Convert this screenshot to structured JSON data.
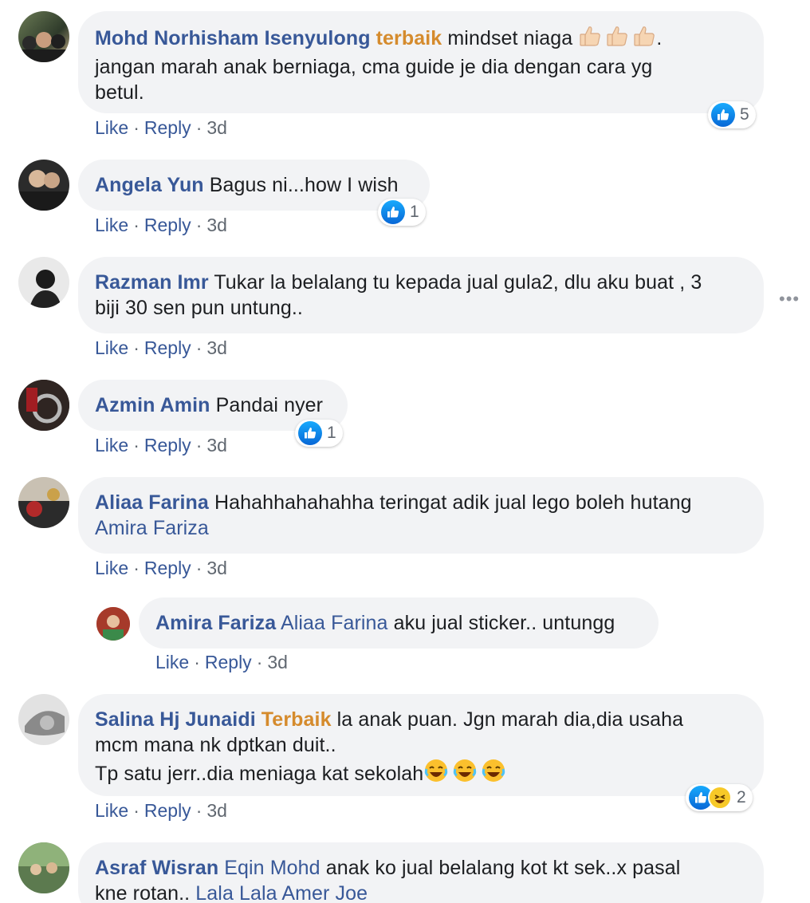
{
  "comments": [
    {
      "author": "Mohd Norhisham Isenyulong",
      "highlight": "terbaik",
      "text_a": " mindset niaga ",
      "text_b": ".",
      "line2": "jangan marah anak berniaga, cma guide je dia dengan cara yg",
      "line3": "betul.",
      "like": "Like",
      "reply": "Reply",
      "time": "3d",
      "reaction_count": "5"
    },
    {
      "author": "Angela Yun",
      "text": "Bagus ni...how I wish",
      "like": "Like",
      "reply": "Reply",
      "time": "3d",
      "reaction_count": "1"
    },
    {
      "author": "Razman Imr",
      "text": "Tukar la belalang tu kepada jual gula2, dlu aku buat , 3",
      "line2": "biji 30 sen pun untung..",
      "like": "Like",
      "reply": "Reply",
      "time": "3d"
    },
    {
      "author": "Azmin Amin",
      "text": "Pandai nyer",
      "like": "Like",
      "reply": "Reply",
      "time": "3d",
      "reaction_count": "1"
    },
    {
      "author": "Aliaa Farina",
      "text": "Hahahhahahahha teringat adik jual lego boleh hutang",
      "tag": "Amira Fariza",
      "like": "Like",
      "reply": "Reply",
      "time": "3d"
    },
    {
      "author": "Amira Fariza",
      "tag": "Aliaa Farina",
      "text": "aku jual sticker.. untungg",
      "like": "Like",
      "reply": "Reply",
      "time": "3d"
    },
    {
      "author": "Salina Hj Junaidi",
      "highlight": "Terbaik",
      "text": " la anak puan. Jgn marah dia,dia usaha",
      "line2": "mcm mana nk dptkan duit..",
      "line3": "Tp satu jerr..dia meniaga kat sekolah",
      "like": "Like",
      "reply": "Reply",
      "time": "3d",
      "reaction_count": "2"
    },
    {
      "author": "Asraf Wisran",
      "tag": "Eqin Mohd",
      "text": " anak ko jual belalang kot kt sek..x pasal",
      "line2": "kne rotan.. ",
      "tag2": "Lala Lala Amer Joe"
    }
  ],
  "icons": {
    "thumbs_up_emoji": "👍",
    "laughing_emoji": "😂",
    "like_reaction": "like-icon",
    "haha_reaction": "haha-icon",
    "more_options": "more-options-icon"
  },
  "colors": {
    "name_blue": "#385898",
    "highlight_orange": "#d58b2d",
    "bubble_gray": "#f2f3f5",
    "meta_gray": "#606770"
  }
}
